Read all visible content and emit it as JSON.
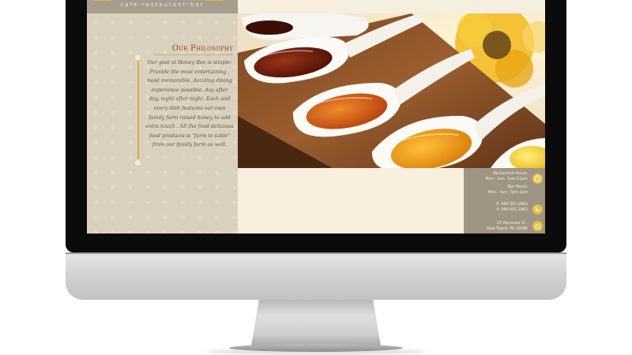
{
  "header": {
    "tagline": "café-restaurant-bar"
  },
  "philosophy": {
    "title": "Our Philosophy",
    "body_lines": [
      "Our goal at Honey Bee is simple:",
      "Provide the most entertaining ,",
      "most memorable, dazzling dining",
      "experience possible, day after",
      "day, night after night.  Each and",
      "every dish features our own",
      "family farm raised honey to add",
      "extra touch . All the food delicious",
      "food products is \"farm to table\"",
      "from our family farm as well."
    ]
  },
  "info": {
    "restaurant_hours_label": "Restaurant Hours:",
    "restaurant_hours": "Mon - Sun: 7pm-11pm",
    "bar_hours_label": "Bar Hours:",
    "bar_hours": "Mon - Sun: 7pm-2am",
    "phone": "P: 484.601.2862",
    "fax": "F: 484.601.2863",
    "address_line1": "23 Devorate St.,",
    "address_line2": "New Tripoli, PA 18066",
    "icons": [
      "clock-icon",
      "phone-icon",
      "home-icon"
    ]
  },
  "colors": {
    "sidebar": "#d9d0bd",
    "title_red": "#b03a1e",
    "honey_gold": "#d6b23a",
    "info_panel": "#9e9584",
    "cream": "#f8efdd"
  }
}
